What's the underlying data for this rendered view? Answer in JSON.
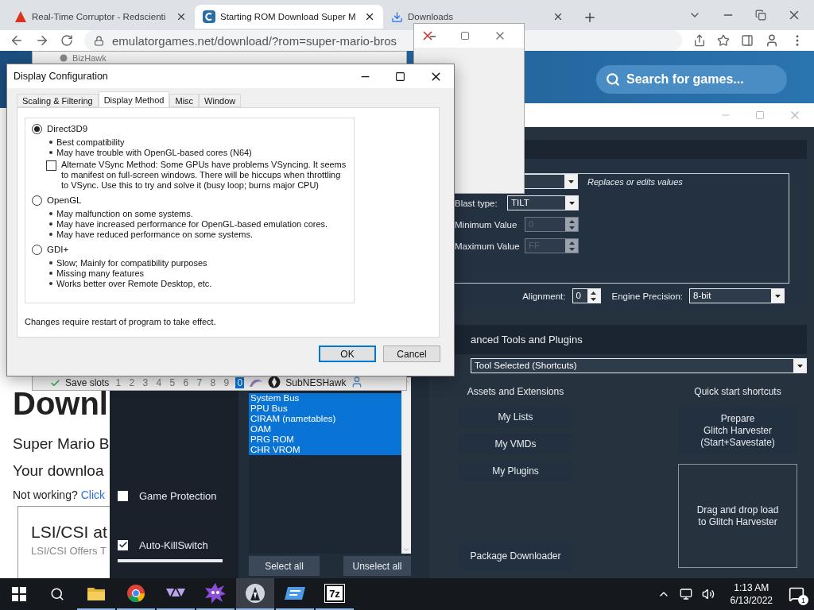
{
  "browser": {
    "tabs": [
      {
        "kind": "corruptor",
        "title": "Real-Time Corruptor - Redscienti",
        "selected": false
      },
      {
        "kind": "site",
        "title": "Starting ROM Download Super M",
        "selected": true
      },
      {
        "kind": "downloads",
        "title": "Downloads",
        "selected": false
      }
    ],
    "address": "emulatorgames.net/download/?rom=super-mario-bros",
    "search": {
      "placeholder": "Search for games..."
    },
    "page": {
      "heading": "Downl",
      "subtitle": "Super Mario B",
      "note": "Your downloa",
      "help": "Not working?",
      "help_link": "Click",
      "ad": {
        "title": "LSI/CSI at",
        "text": "LSI/CSI Offers T"
      }
    }
  },
  "rtc": {
    "engine": {
      "description": "Replaces or edits values",
      "blast_type": {
        "label": "Blast type:",
        "value": "TILT"
      },
      "minimum": {
        "label": "Minimum Value",
        "value": "0",
        "disabled": true
      },
      "maximum": {
        "label": "Maximum Value",
        "value": "FF",
        "disabled": true
      },
      "alignment": {
        "label": "Alignment:",
        "value": "0"
      },
      "precision": {
        "label": "Engine Precision:",
        "value": "8-bit"
      }
    },
    "tools": {
      "heading": "anced Tools and Plugins",
      "selector": "Tool Selected (Shortcuts)"
    },
    "assets": {
      "heading": "Assets and Extensions",
      "buttons": [
        "My Lists",
        "My VMDs",
        "My Plugins"
      ],
      "downloader": "Package Downloader"
    },
    "shortcuts": {
      "heading": "Quick start shortcuts",
      "prepare": "Prepare\nGlitch Harvester\n(Start+Savestate)",
      "drop_zone": "Drag and drop load\nto Glitch Harvester"
    },
    "options": [
      {
        "label": "Game Protection",
        "checked": false
      },
      {
        "label": "Auto-KillSwitch",
        "checked": true
      }
    ],
    "memory_domains": {
      "items": [
        {
          "label": "System Bus",
          "selected": true
        },
        {
          "label": "PPU Bus",
          "selected": true
        },
        {
          "label": "CIRAM (nametables)",
          "selected": true
        },
        {
          "label": "OAM",
          "selected": true
        },
        {
          "label": "PRG ROM",
          "selected": true
        },
        {
          "label": "CHR VROM",
          "selected": true
        }
      ],
      "buttons": [
        "Select all",
        "Unselect all"
      ]
    }
  },
  "bizhawk": {
    "title": "BizHawk",
    "status_bar": {
      "label": "Save slots",
      "slots": [
        {
          "label": "1",
          "selected": false
        },
        {
          "label": "2",
          "selected": false
        },
        {
          "label": "3",
          "selected": false
        },
        {
          "label": "4",
          "selected": false
        },
        {
          "label": "5",
          "selected": false
        },
        {
          "label": "6",
          "selected": false
        },
        {
          "label": "7",
          "selected": false
        },
        {
          "label": "8",
          "selected": false
        },
        {
          "label": "9",
          "selected": false
        },
        {
          "label": "0",
          "selected": true
        }
      ],
      "core": "SubNESHawk"
    }
  },
  "dialog": {
    "title": "Display Configuration",
    "tabs": [
      {
        "label": "Scaling & Filtering",
        "selected": false
      },
      {
        "label": "Display Method",
        "selected": true
      },
      {
        "label": "Misc",
        "selected": false
      },
      {
        "label": "Window",
        "selected": false
      }
    ],
    "options": [
      {
        "label": "Direct3D9",
        "selected": true,
        "bullets": [
          "Best compatibility",
          "May have trouble with OpenGL-based cores (N64)"
        ],
        "extra": {
          "label": "Alternate VSync Method: Some GPUs have problems VSyncing. It seems to manifest on full-screen windows. There will be hiccups when throttling to VSync. Use this to try and solve it (busy loop; burns major CPU)",
          "checked": false
        }
      },
      {
        "label": "OpenGL",
        "selected": false,
        "bullets": [
          "May malfunction on some systems.",
          "May have increased performance for OpenGL-based emulation cores.",
          "May have reduced performance on some systems."
        ]
      },
      {
        "label": "GDI+",
        "selected": false,
        "bullets": [
          "Slow; Mainly for compatibility purposes",
          "Missing many features",
          "Works better over Remote Desktop, etc."
        ]
      }
    ],
    "note": "Changes require restart of program to take effect.",
    "buttons": [
      {
        "label": "OK",
        "default": true
      },
      {
        "label": "Cancel",
        "default": false
      }
    ]
  },
  "taskbar": {
    "apps": [
      {
        "kind": "explorer",
        "running": true,
        "active": false
      },
      {
        "kind": "chrome",
        "running": true,
        "active": false
      },
      {
        "kind": "triangles",
        "running": true,
        "active": false
      },
      {
        "kind": "spiky",
        "running": true,
        "active": false
      },
      {
        "kind": "rtc",
        "running": true,
        "active": true
      },
      {
        "kind": "card",
        "running": true,
        "active": false
      },
      {
        "kind": "archive",
        "label": "7z",
        "running": true,
        "active": false
      }
    ],
    "time": "1:13 AM",
    "date": "6/13/2022",
    "notifications": "1"
  }
}
